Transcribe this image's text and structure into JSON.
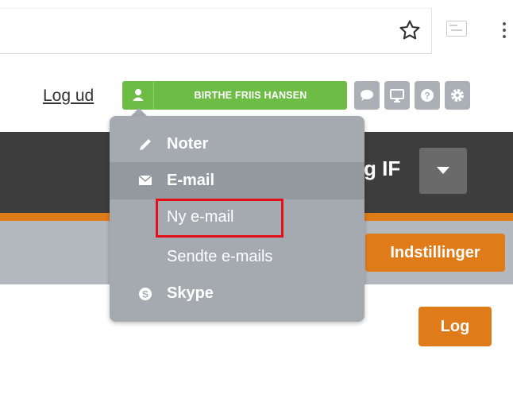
{
  "header": {
    "logout_label": "Log ud",
    "user_name": "BIRTHE FRIIS HANSEN"
  },
  "page": {
    "club_name_fragment": "g IF",
    "settings_label": "Indstillinger",
    "log_label": "Log"
  },
  "menu": {
    "notes_label": "Noter",
    "email_label": "E-mail",
    "new_email_label": "Ny e-mail",
    "sent_emails_label": "Sendte e-mails",
    "skype_label": "Skype"
  },
  "icons": [
    "star-icon",
    "extension-icon",
    "menu-dots-icon",
    "user-icon",
    "chat-icon",
    "monitor-icon",
    "help-icon",
    "settings-icon",
    "chevron-down-icon",
    "pencil-icon",
    "envelope-icon",
    "skype-icon"
  ],
  "colors": {
    "green": "#6dbc45",
    "orange": "#e07b1a",
    "dark_header": "#3d3d3d",
    "menu_bg": "#a4aab0",
    "highlight": "#e3101a"
  }
}
